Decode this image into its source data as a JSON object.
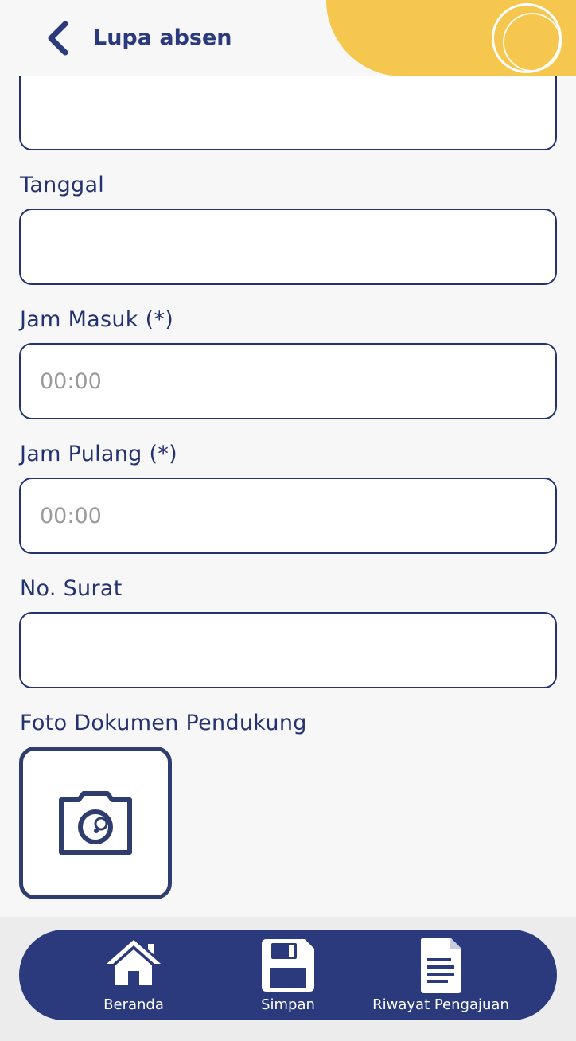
{
  "header": {
    "title": "Lupa absen",
    "back_icon": "chevron-left-icon",
    "accent_color": "#f6c74f",
    "brand_color": "#2b3a7c"
  },
  "form": {
    "tanggal_label": "Tanggal",
    "tanggal_value": "",
    "jam_masuk_label": "Jam Masuk (*)",
    "jam_masuk_placeholder": "00:00",
    "jam_pulang_label": "Jam Pulang (*)",
    "jam_pulang_placeholder": "00:00",
    "no_surat_label": "No. Surat",
    "no_surat_value": "",
    "foto_label": "Foto Dokumen Pendukung",
    "foto_icon": "camera-icon"
  },
  "bottom_nav": {
    "items": [
      {
        "label": "Beranda",
        "icon": "home-icon"
      },
      {
        "label": "Simpan",
        "icon": "save-icon"
      },
      {
        "label": "Riwayat Pengajuan",
        "icon": "document-icon"
      }
    ]
  }
}
